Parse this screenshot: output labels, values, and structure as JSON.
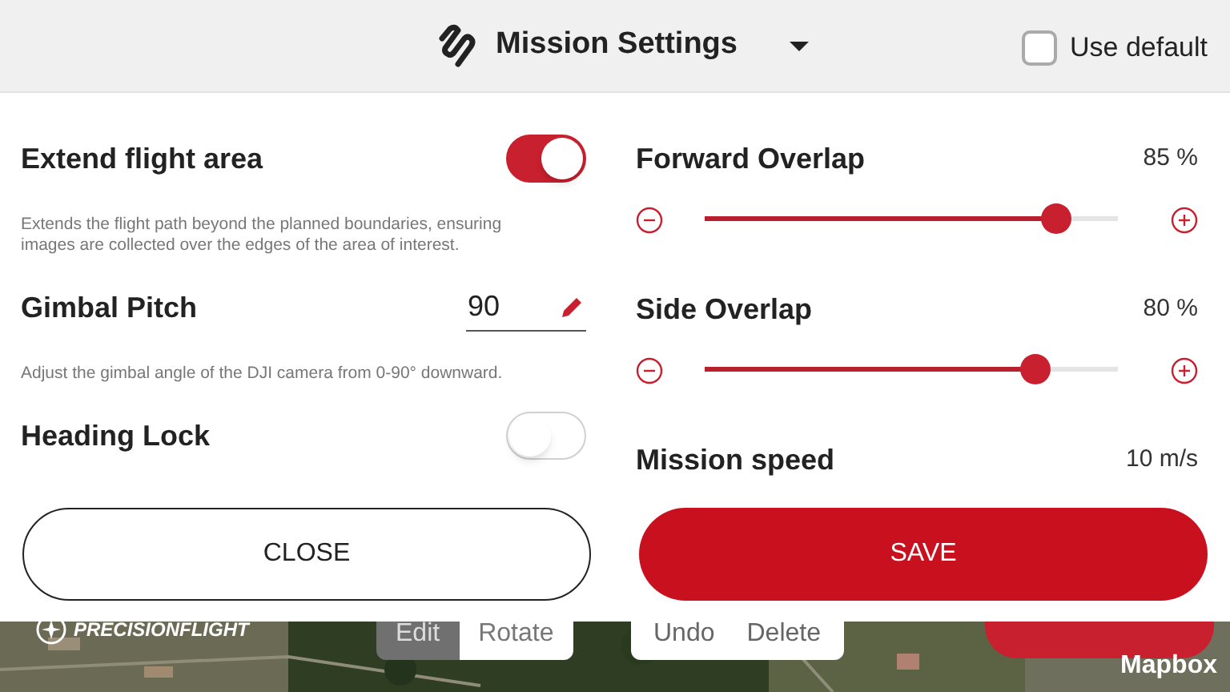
{
  "header": {
    "title": "Mission Settings",
    "use_default": {
      "label": "Use default",
      "checked": false
    }
  },
  "left": [
    {
      "kind": "toggle",
      "label": "Extend flight area",
      "on": true,
      "description": "Extends the flight path beyond the planned boundaries, ensuring images are collected over the edges of the area of interest."
    },
    {
      "kind": "input",
      "label": "Gimbal Pitch",
      "value": "90",
      "description": "Adjust the gimbal angle of the DJI camera from 0-90° downward."
    },
    {
      "kind": "toggle",
      "label": "Heading Lock",
      "on": false
    }
  ],
  "right": [
    {
      "kind": "slider",
      "label": "Forward Overlap",
      "reading": "85 %",
      "level": 0.85
    },
    {
      "kind": "slider",
      "label": "Side Overlap",
      "reading": "80 %",
      "level": 0.8
    },
    {
      "kind": "value",
      "label": "Mission speed",
      "reading": "10 m/s"
    }
  ],
  "buttons": [
    {
      "label": "CLOSE",
      "kind": "secondary"
    },
    {
      "label": "SAVE",
      "kind": "primary"
    }
  ],
  "map": {
    "logo": "PRECISIONFLIGHT",
    "mode_tabs": [
      {
        "label": "Edit",
        "selected": true
      },
      {
        "label": "Rotate",
        "selected": false
      }
    ],
    "actions": [
      "Undo",
      "Delete"
    ],
    "attribution": "Mapbox"
  }
}
